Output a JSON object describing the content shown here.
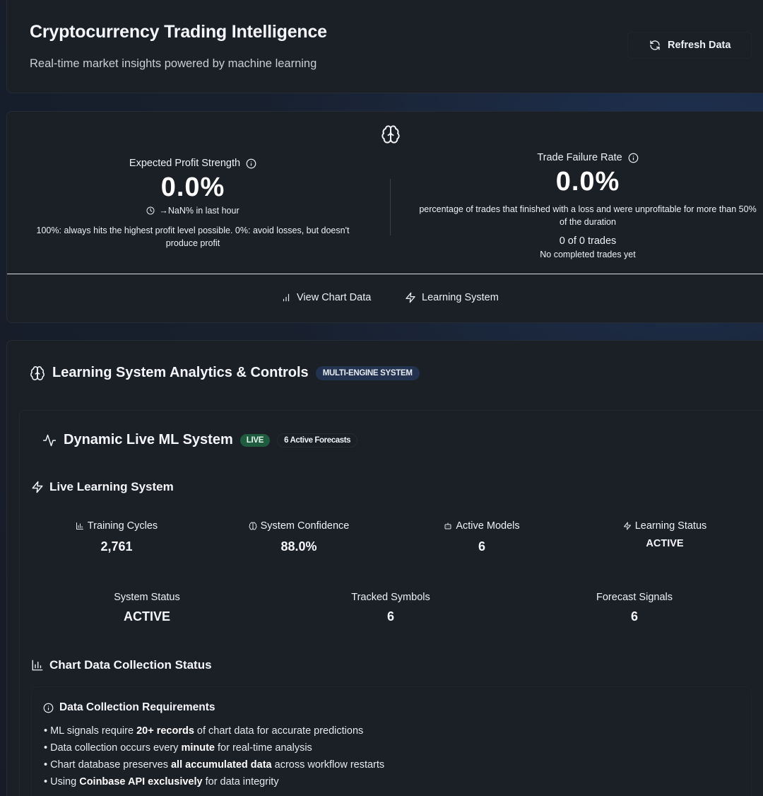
{
  "header": {
    "title": "Cryptocurrency Trading Intelligence",
    "subtitle": "Real-time market insights powered by machine learning",
    "refresh_label": "Refresh Data"
  },
  "metrics": {
    "profit": {
      "label": "Expected Profit Strength",
      "value": "0.0%",
      "change": "→NaN% in last hour",
      "description": "100%: always hits the highest profit level possible. 0%: avoid losses, but doesn't produce profit"
    },
    "failure": {
      "label": "Trade Failure Rate",
      "value": "0.0%",
      "description": "percentage of trades that finished with a loss and were unprofitable for more than 50% of the duration",
      "count": "0 of 0 trades",
      "note": "No completed trades yet"
    },
    "links": {
      "chart": "View Chart Data",
      "learning": "Learning System"
    }
  },
  "analytics": {
    "title": "Learning System Analytics & Controls",
    "badge": "MULTI-ENGINE SYSTEM",
    "ml_system": {
      "title": "Dynamic Live ML System",
      "live_badge": "LIVE",
      "forecasts_badge": "6 Active Forecasts"
    },
    "live_learning": {
      "title": "Live Learning System",
      "stats": [
        {
          "label": "Training Cycles",
          "value": "2,761",
          "icon": "bar-chart-icon"
        },
        {
          "label": "System Confidence",
          "value": "88.0%",
          "icon": "brain-icon"
        },
        {
          "label": "Active Models",
          "value": "6",
          "icon": "bot-icon"
        },
        {
          "label": "Learning Status",
          "value": "ACTIVE",
          "icon": "zap-icon"
        }
      ],
      "status_stats": [
        {
          "label": "System Status",
          "value": "ACTIVE"
        },
        {
          "label": "Tracked Symbols",
          "value": "6"
        },
        {
          "label": "Forecast Signals",
          "value": "6"
        }
      ]
    },
    "chart_collection": {
      "title": "Chart Data Collection Status",
      "requirements_title": "Data Collection Requirements",
      "requirements": [
        {
          "pre": "• ML signals require ",
          "bold": "20+ records",
          "post": " of chart data for accurate predictions"
        },
        {
          "pre": "• Data collection occurs every ",
          "bold": "minute",
          "post": " for real-time analysis"
        },
        {
          "pre": "• Chart database preserves ",
          "bold": "all accumulated data",
          "post": " across workflow restarts"
        },
        {
          "pre": "• Using ",
          "bold": "Coinbase API exclusively",
          "post": " for data integrity"
        }
      ]
    }
  }
}
